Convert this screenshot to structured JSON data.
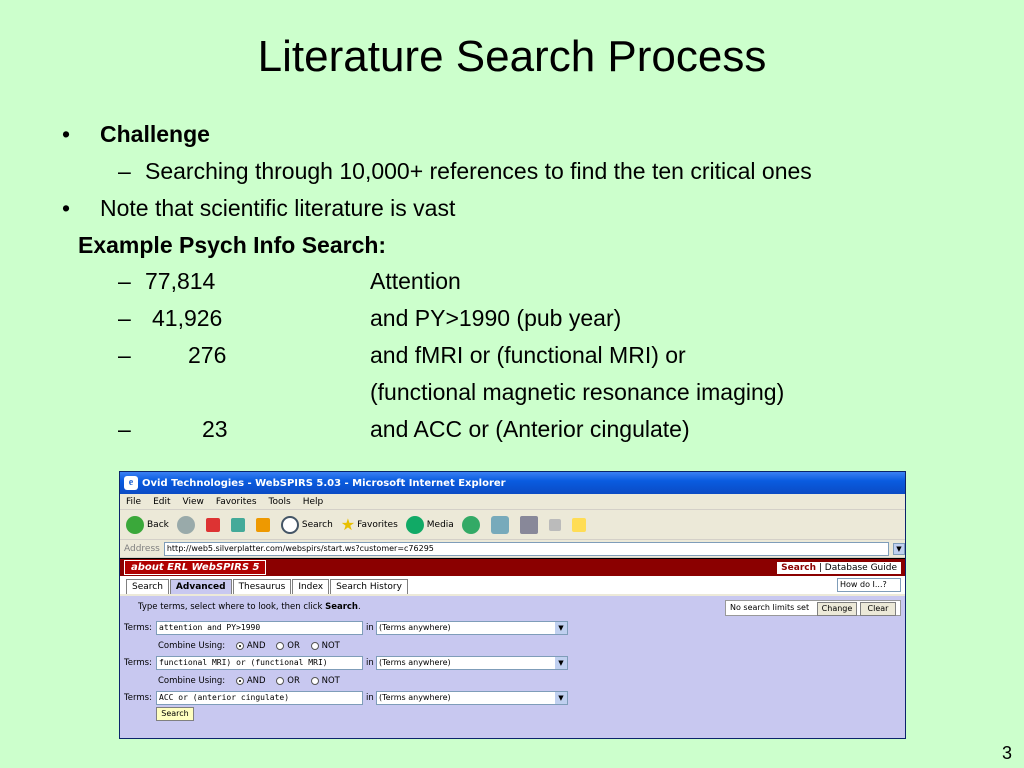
{
  "slide": {
    "title": "Literature Search Process",
    "bullet1": "Challenge",
    "bullet1_sub": "Searching through 10,000+ references to find the ten critical ones",
    "bullet2": "Note that scientific literature is vast",
    "example_heading": "Example Psych Info Search:",
    "bullet_char": "•",
    "dash_char": "–",
    "rows": [
      {
        "count": "77,814",
        "text": "Attention"
      },
      {
        "count": "41,926",
        "text": "and PY>1990 (pub year)"
      },
      {
        "count": "276",
        "text": "and fMRI or (functional MRI) or"
      },
      {
        "count": "",
        "text": "(functional magnetic resonance imaging)"
      },
      {
        "count": "23",
        "text": "and ACC or (Anterior cingulate)"
      }
    ],
    "page_number": "3"
  },
  "browser": {
    "title": "Ovid Technologies - WebSPIRS 5.03 - Microsoft Internet Explorer",
    "menu": [
      "File",
      "Edit",
      "View",
      "Favorites",
      "Tools",
      "Help"
    ],
    "toolbar": {
      "back": "Back",
      "search": "Search",
      "favorites": "Favorites",
      "media": "Media"
    },
    "address_label": "Address",
    "address_url": "http://web5.silverplatter.com/webspirs/start.ws?customer=c76295",
    "logo_text": "about ERL WebSPIRS 5",
    "top_links": {
      "search": "Search",
      "separator": " | ",
      "guide": "Database Guide"
    },
    "tabs": [
      "Search",
      "Advanced",
      "Thesaurus",
      "Index",
      "Search History"
    ],
    "howdoi": "How do I...?",
    "instructions_prefix": "Type terms, select where to look, then click ",
    "instructions_bold": "Search",
    "instructions_suffix": ".",
    "limits_text": "No search limits set",
    "change_button": "Change",
    "clear_button": "Clear",
    "terms_label": "Terms:",
    "in_label": "in",
    "combine_label": "Combine Using:",
    "and_label": "AND",
    "or_label": "OR",
    "not_label": "NOT",
    "term1": "attention and PY>1990",
    "term2": "functional MRI) or (functional MRI)",
    "term3": "ACC or (anterior cingulate)",
    "field_select": "(Terms anywhere)",
    "search_button": "Search"
  }
}
